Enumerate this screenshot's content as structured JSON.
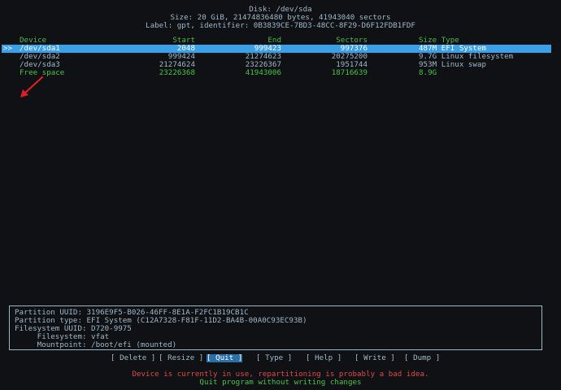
{
  "header": {
    "disk": "Disk: /dev/sda",
    "size": "Size: 20 GiB, 21474836480 bytes, 41943040 sectors",
    "label": "Label: gpt, identifier: 0B3839CE-7BD3-48CC-8F29-D6F12FDB1FDF"
  },
  "table": {
    "columns": {
      "device": "Device",
      "start": "Start",
      "end": "End",
      "sectors": "Sectors",
      "size": "Size",
      "type": "Type"
    },
    "selector": ">>",
    "rows": [
      {
        "device": "/dev/sda1",
        "start": "2048",
        "end": "999423",
        "sectors": "997376",
        "size": "487M",
        "type": "EFI System"
      },
      {
        "device": "/dev/sda2",
        "start": "999424",
        "end": "21274623",
        "sectors": "20275200",
        "size": "9.7G",
        "type": "Linux filesystem"
      },
      {
        "device": "/dev/sda3",
        "start": "21274624",
        "end": "23226367",
        "sectors": "1951744",
        "size": "953M",
        "type": "Linux swap"
      },
      {
        "device": "Free space",
        "start": "23226368",
        "end": "41943006",
        "sectors": "18716639",
        "size": "8.9G",
        "type": ""
      }
    ]
  },
  "info": {
    "partition_uuid": "Partition UUID: 3196E9F5-B026-46FF-8E1A-F2FC1B19CB1C",
    "partition_type": "Partition type: EFI System (C12A7328-F81F-11D2-BA4B-00A0C93EC93B)",
    "filesystem_uuid": "Filesystem UUID: D720-9975",
    "filesystem": "     Filesystem: vfat",
    "mountpoint": "     Mountpoint: /boot/efi (mounted)"
  },
  "menu": {
    "delete": "[ Delete ]",
    "resize": "[ Resize ]",
    "quit": "[ Quit ]",
    "type": "[ Type ]",
    "help": "[ Help ]",
    "write": "[ Write ]",
    "dump": "[ Dump ]"
  },
  "messages": {
    "warning": "Device is currently in use, repartitioning is probably a bad idea.",
    "status": "Quit program without writing changes"
  },
  "colors": {
    "background": "#0f1115",
    "selection": "#3aa0e8",
    "header_green": "#56b84b",
    "warning_red": "#e04848",
    "annotation_arrow": "#e02020"
  }
}
